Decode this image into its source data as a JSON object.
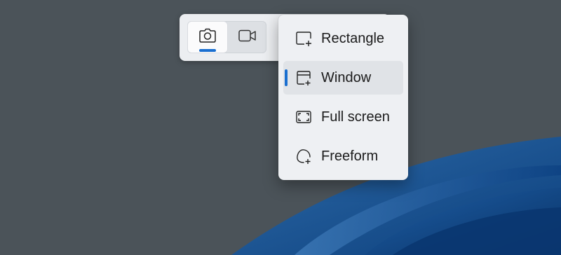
{
  "desktop": {
    "background_color": "#4b5359",
    "wallpaper_accent": "#0f4c95"
  },
  "toolbar": {
    "modes": [
      {
        "icon": "camera-icon",
        "active": true
      },
      {
        "icon": "video-camera-icon",
        "active": false
      }
    ],
    "accent_color": "#1a6fd0"
  },
  "snip_menu": {
    "items": [
      {
        "label": "Rectangle",
        "icon": "rectangle-snip-icon",
        "selected": false
      },
      {
        "label": "Window",
        "icon": "window-snip-icon",
        "selected": true
      },
      {
        "label": "Full screen",
        "icon": "fullscreen-snip-icon",
        "selected": false
      },
      {
        "label": "Freeform",
        "icon": "freeform-snip-icon",
        "selected": false
      }
    ]
  }
}
